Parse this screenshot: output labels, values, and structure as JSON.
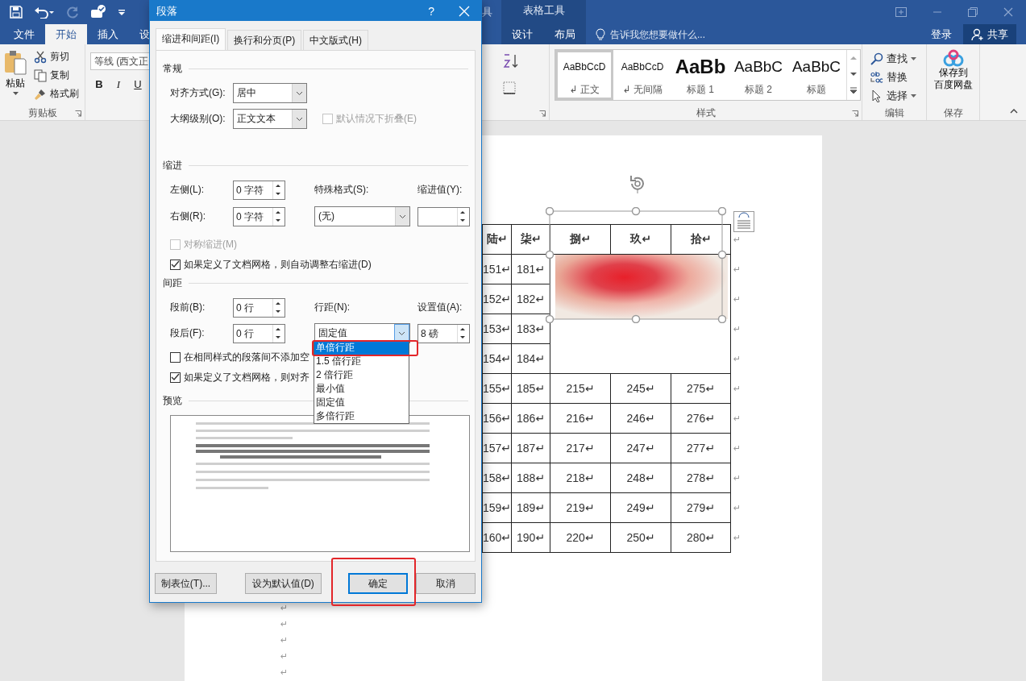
{
  "word": {
    "context_fragment": "具",
    "context_group": "表格工具",
    "tabs": [
      {
        "label": "文件",
        "selected": false
      },
      {
        "label": "开始",
        "selected": true
      },
      {
        "label": "插入",
        "selected": false
      },
      {
        "label": "设",
        "selected": false
      }
    ],
    "context_tabs": [
      {
        "label": "设计",
        "selected": false
      },
      {
        "label": "布局",
        "selected": false
      }
    ],
    "tell_me": {
      "placeholder": "告诉我您想要做什么..."
    },
    "sign_in": "登录",
    "share": "共享",
    "clipboard": {
      "paste": "粘贴",
      "items": [
        "剪切",
        "复制",
        "格式刷"
      ],
      "group_label": "剪贴板"
    },
    "font": {
      "font_name": "等线 (西文正",
      "format_buttons": [
        "B",
        "I",
        "U"
      ]
    },
    "styles": {
      "items": [
        {
          "sample": "AaBbCcD",
          "name": "↲ 正文",
          "kind": "body",
          "selected": true
        },
        {
          "sample": "AaBbCcD",
          "name": "↲ 无间隔",
          "kind": "body",
          "selected": false
        },
        {
          "sample": "AaBb",
          "name": "标题 1",
          "kind": "heading1",
          "selected": false
        },
        {
          "sample": "AaBbC",
          "name": "标题 2",
          "kind": "heading2",
          "selected": false
        },
        {
          "sample": "AaBbC",
          "name": "标题",
          "kind": "title",
          "selected": false
        }
      ],
      "group_label": "样式"
    },
    "editing": {
      "items": [
        "查找",
        "替换",
        "选择"
      ],
      "group_label": "编辑"
    },
    "save": {
      "lines": [
        "保存到",
        "百度网盘"
      ],
      "group_label": "保存"
    }
  },
  "document": {
    "table": {
      "columns": [
        "陆↵",
        "柒↵",
        "捌↵",
        "玖↵",
        "拾↵"
      ],
      "header_end_mark": "↵",
      "rows": [
        {
          "cells": [
            "151↵",
            "181↵"
          ],
          "end_mark": "↵"
        },
        {
          "cells": [
            "152↵",
            "182↵"
          ],
          "end_mark": "↵"
        },
        {
          "cells": [
            "153↵",
            "183↵"
          ],
          "end_mark": "↵"
        },
        {
          "cells": [
            "154↵",
            "184↵"
          ],
          "end_mark": "↵"
        },
        {
          "cells": [
            "155↵",
            "185↵",
            "215↵",
            "245↵",
            "275↵"
          ],
          "end_mark": "↵"
        },
        {
          "cells": [
            "156↵",
            "186↵",
            "216↵",
            "246↵",
            "276↵"
          ],
          "end_mark": "↵"
        },
        {
          "cells": [
            "157↵",
            "187↵",
            "217↵",
            "247↵",
            "277↵"
          ],
          "end_mark": "↵"
        },
        {
          "cells": [
            "158↵",
            "188↵",
            "218↵",
            "248↵",
            "278↵"
          ],
          "end_mark": "↵"
        },
        {
          "cells": [
            "159↵",
            "189↵",
            "219↵",
            "249↵",
            "279↵"
          ],
          "end_mark": "↵"
        },
        {
          "cells": [
            "160↵",
            "190↵",
            "220↵",
            "250↵",
            "280↵"
          ],
          "end_mark": "↵"
        }
      ]
    },
    "paragraph_marks": [
      "↵",
      "↵",
      "↵",
      "↵",
      "↵"
    ]
  },
  "dialog": {
    "title": "段落",
    "help": "?",
    "tabs": [
      {
        "label": "缩进和间距(I)",
        "selected": true
      },
      {
        "label": "换行和分页(P)",
        "selected": false
      },
      {
        "label": "中文版式(H)",
        "selected": false
      }
    ],
    "general": {
      "heading": "常规",
      "alignment": {
        "label": "对齐方式(G):",
        "value": "居中"
      },
      "outline_level": {
        "label": "大纲级别(O):",
        "value": "正文文本"
      },
      "collapse": {
        "label": "默认情况下折叠(E)",
        "checked": false,
        "disabled": true
      }
    },
    "indent": {
      "heading": "缩进",
      "left": {
        "label": "左侧(L):",
        "value": "0 字符"
      },
      "right": {
        "label": "右侧(R):",
        "value": "0 字符"
      },
      "special": {
        "label": "特殊格式(S):",
        "value": "(无)"
      },
      "by": {
        "label": "缩进值(Y):"
      },
      "mirror": {
        "label": "对称缩进(M)",
        "checked": false,
        "disabled": true
      },
      "auto_adjust": {
        "label": "如果定义了文档网格，则自动调整右缩进(D)",
        "checked": true,
        "disabled": false
      }
    },
    "spacing": {
      "heading": "间距",
      "before": {
        "label": "段前(B):",
        "value": "0 行"
      },
      "after": {
        "label": "段后(F):",
        "value": "0 行"
      },
      "line_spacing": {
        "label": "行距(N):",
        "value": "固定值",
        "expanded": true
      },
      "at": {
        "label": "设置值(A):",
        "value": "8 磅"
      },
      "no_space": {
        "label": "在相同样式的段落间不添加空",
        "checked": false,
        "disabled": false
      },
      "snap": {
        "label": "如果定义了文档网格，则对齐",
        "checked": true,
        "disabled": false
      }
    },
    "preview": {
      "heading": "预览"
    },
    "line_spacing_options": [
      {
        "label": "单倍行距",
        "selected": true
      },
      {
        "label": "1.5 倍行距",
        "selected": false
      },
      {
        "label": "2 倍行距",
        "selected": false
      },
      {
        "label": "最小值",
        "selected": false
      },
      {
        "label": "固定值",
        "selected": false
      },
      {
        "label": "多倍行距",
        "selected": false
      }
    ],
    "buttons": [
      {
        "label": "制表位(T)...",
        "default": false
      },
      {
        "label": "设为默认值(D)",
        "default": false
      },
      {
        "label": "确定",
        "default": true
      },
      {
        "label": "取消",
        "default": false
      }
    ]
  }
}
